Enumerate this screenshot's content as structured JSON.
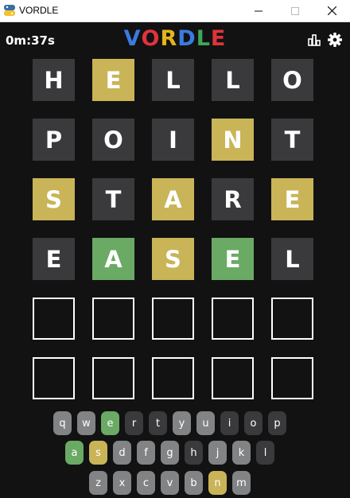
{
  "window": {
    "title": "VORDLE"
  },
  "header": {
    "timer": "0m:37s",
    "logo": [
      {
        "ch": "V",
        "color": "#3b7be0"
      },
      {
        "ch": "O",
        "color": "#e0333b"
      },
      {
        "ch": "R",
        "color": "#e3b51b"
      },
      {
        "ch": "D",
        "color": "#3b7be0"
      },
      {
        "ch": "L",
        "color": "#3fa858"
      },
      {
        "ch": "E",
        "color": "#e0333b"
      }
    ],
    "stats_icon": "bar-chart-icon",
    "settings_icon": "gear-icon"
  },
  "colors": {
    "background": "#121213",
    "absent": "#3a3a3c",
    "present": "#c9b458",
    "correct": "#6aaa64",
    "unused_key": "#818384"
  },
  "board": {
    "rows": [
      [
        {
          "l": "H",
          "s": "absent"
        },
        {
          "l": "E",
          "s": "present"
        },
        {
          "l": "L",
          "s": "absent"
        },
        {
          "l": "L",
          "s": "absent"
        },
        {
          "l": "O",
          "s": "absent"
        }
      ],
      [
        {
          "l": "P",
          "s": "absent"
        },
        {
          "l": "O",
          "s": "absent"
        },
        {
          "l": "I",
          "s": "absent"
        },
        {
          "l": "N",
          "s": "present"
        },
        {
          "l": "T",
          "s": "absent"
        }
      ],
      [
        {
          "l": "S",
          "s": "present"
        },
        {
          "l": "T",
          "s": "absent"
        },
        {
          "l": "A",
          "s": "present"
        },
        {
          "l": "R",
          "s": "absent"
        },
        {
          "l": "E",
          "s": "present"
        }
      ],
      [
        {
          "l": "E",
          "s": "absent"
        },
        {
          "l": "A",
          "s": "correct"
        },
        {
          "l": "S",
          "s": "present"
        },
        {
          "l": "E",
          "s": "correct"
        },
        {
          "l": "L",
          "s": "absent"
        }
      ],
      [
        {
          "l": "",
          "s": "empty"
        },
        {
          "l": "",
          "s": "empty"
        },
        {
          "l": "",
          "s": "empty"
        },
        {
          "l": "",
          "s": "empty"
        },
        {
          "l": "",
          "s": "empty"
        }
      ],
      [
        {
          "l": "",
          "s": "empty"
        },
        {
          "l": "",
          "s": "empty"
        },
        {
          "l": "",
          "s": "empty"
        },
        {
          "l": "",
          "s": "empty"
        },
        {
          "l": "",
          "s": "empty"
        }
      ]
    ]
  },
  "keyboard": {
    "rows": [
      [
        {
          "k": "q",
          "s": "unused"
        },
        {
          "k": "w",
          "s": "unused"
        },
        {
          "k": "e",
          "s": "correct"
        },
        {
          "k": "r",
          "s": "absent"
        },
        {
          "k": "t",
          "s": "absent"
        },
        {
          "k": "y",
          "s": "unused"
        },
        {
          "k": "u",
          "s": "unused"
        },
        {
          "k": "i",
          "s": "absent"
        },
        {
          "k": "o",
          "s": "absent"
        },
        {
          "k": "p",
          "s": "absent"
        }
      ],
      [
        {
          "k": "a",
          "s": "correct"
        },
        {
          "k": "s",
          "s": "present"
        },
        {
          "k": "d",
          "s": "unused"
        },
        {
          "k": "f",
          "s": "unused"
        },
        {
          "k": "g",
          "s": "unused"
        },
        {
          "k": "h",
          "s": "absent"
        },
        {
          "k": "j",
          "s": "unused"
        },
        {
          "k": "k",
          "s": "unused"
        },
        {
          "k": "l",
          "s": "absent"
        }
      ],
      [
        {
          "k": "z",
          "s": "unused"
        },
        {
          "k": "x",
          "s": "unused"
        },
        {
          "k": "c",
          "s": "unused"
        },
        {
          "k": "v",
          "s": "unused"
        },
        {
          "k": "b",
          "s": "unused"
        },
        {
          "k": "n",
          "s": "present"
        },
        {
          "k": "m",
          "s": "unused"
        }
      ]
    ]
  }
}
